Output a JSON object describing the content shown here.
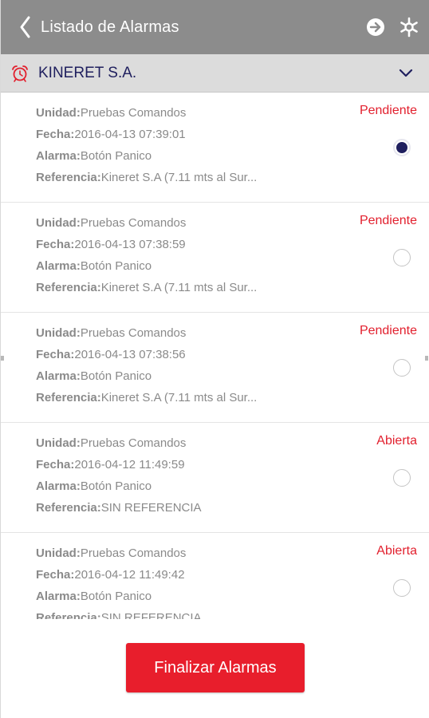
{
  "header": {
    "title": "Listado de Alarmas",
    "background_color": "#8c8c8c",
    "back_icon": "chevron-left-icon",
    "next_icon": "arrow-right-circle-icon",
    "settings_icon": "asterisk-settings-icon"
  },
  "company": {
    "name": "KINERET S.A.",
    "icon": "alarm-clock-icon",
    "expand_icon": "chevron-down-icon",
    "name_color": "#1f1f5e",
    "icon_color": "#e2202e"
  },
  "labels": {
    "unidad": "Unidad:",
    "fecha": "Fecha:",
    "alarma": "Alarma:",
    "referencia": "Referencia:"
  },
  "alarms": [
    {
      "unidad": "Pruebas Comandos",
      "fecha": "2016-04-13 07:39:01",
      "alarma": "Botón Panico",
      "referencia": "Kineret S.A (7.11 mts al Sur...",
      "status": "Pendiente",
      "selected": true
    },
    {
      "unidad": "Pruebas Comandos",
      "fecha": "2016-04-13 07:38:59",
      "alarma": "Botón Panico",
      "referencia": "Kineret S.A (7.11 mts al Sur...",
      "status": "Pendiente",
      "selected": false
    },
    {
      "unidad": "Pruebas Comandos",
      "fecha": "2016-04-13 07:38:56",
      "alarma": "Botón Panico",
      "referencia": "Kineret S.A (7.11 mts al Sur...",
      "status": "Pendiente",
      "selected": false
    },
    {
      "unidad": "Pruebas Comandos",
      "fecha": "2016-04-12 11:49:59",
      "alarma": "Botón Panico",
      "referencia": "SIN REFERENCIA",
      "status": "Abierta",
      "selected": false
    },
    {
      "unidad": "Pruebas Comandos",
      "fecha": "2016-04-12 11:49:42",
      "alarma": "Botón Panico",
      "referencia": "SIN REFERENCIA",
      "status": "Abierta",
      "selected": false
    }
  ],
  "colors": {
    "status": "#e2202e",
    "selected_radio": "#1f1f5e",
    "primary_button": "#e81e2c"
  },
  "footer": {
    "finalize_label": "Finalizar Alarmas"
  }
}
